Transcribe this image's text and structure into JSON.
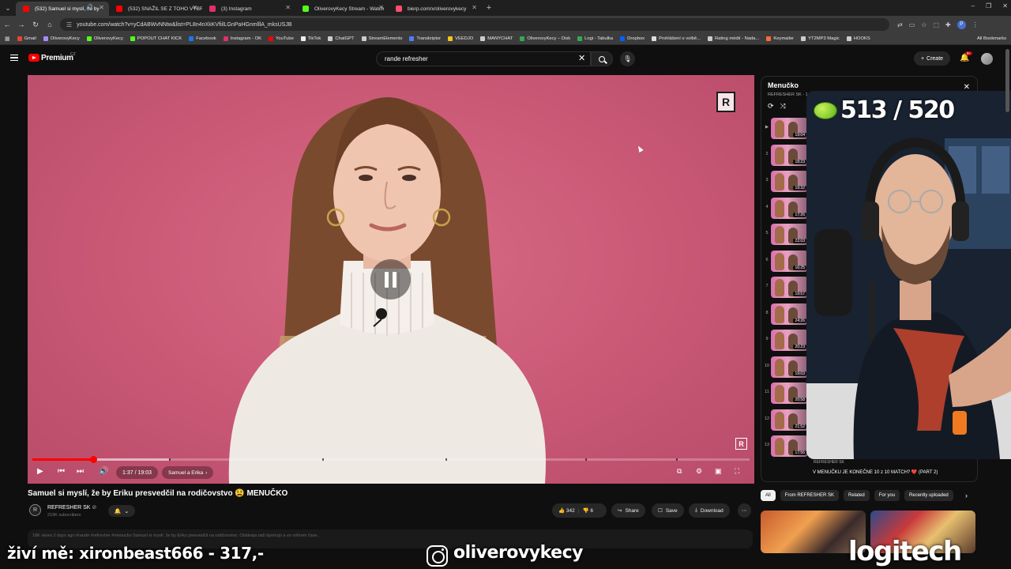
{
  "browser": {
    "tabs": [
      {
        "title": "(532) Samuel si myslí, že by",
        "favicon_color": "#ff0000",
        "active": true,
        "extra": "🔊"
      },
      {
        "title": "(532) SNAŽIL SE Z TOHO VYBR",
        "favicon_color": "#ff0000",
        "active": false
      },
      {
        "title": "(3) Instagram",
        "favicon_color": "#e1306c",
        "active": false
      },
      {
        "title": "OliverovyKecy Stream - Watch",
        "favicon_color": "#53fc18",
        "active": false
      },
      {
        "title": "bierp.com/x/oliverovykecy",
        "favicon_color": "#ff4d6d",
        "active": false
      }
    ],
    "url": "youtube.com/watch?v=yCdABWvNNtw&list=PL8n4nXkKVfiilLGnPaHGnmlllA_mksUSJB",
    "profile_initial": "P",
    "bookmarks": [
      {
        "label": "Gmail",
        "color": "#ea4335"
      },
      {
        "label": "OliverovyKecy",
        "color": "#a78bfa"
      },
      {
        "label": "OliverovyKecy",
        "color": "#53fc18"
      },
      {
        "label": "POPOUT CHAT KICK",
        "color": "#53fc18"
      },
      {
        "label": "Facebook",
        "color": "#1877f2"
      },
      {
        "label": "Instagram - OK",
        "color": "#e1306c"
      },
      {
        "label": "YouTube",
        "color": "#ff0000"
      },
      {
        "label": "TikTok",
        "color": "#eeeeee"
      },
      {
        "label": "ChatGPT",
        "color": "#cccccc"
      },
      {
        "label": "StreamElements",
        "color": "#cccccc"
      },
      {
        "label": "Transkriptor",
        "color": "#4f7cff"
      },
      {
        "label": "VEEDJO",
        "color": "#f5c518"
      },
      {
        "label": "MANYCHAT",
        "color": "#cccccc"
      },
      {
        "label": "OliverovyKecy – Disk",
        "color": "#34a853"
      },
      {
        "label": "Logi - Tabulka",
        "color": "#34a853"
      },
      {
        "label": "Dropbox",
        "color": "#0061ff"
      },
      {
        "label": "Prohlášení o volbě...",
        "color": "#dddddd"
      },
      {
        "label": "Rating médií - Nada...",
        "color": "#cccccc"
      },
      {
        "label": "Keymailer",
        "color": "#ff6b35"
      },
      {
        "label": "YT2MP3 Magic",
        "color": "#cccccc"
      },
      {
        "label": "HOOKS",
        "color": "#cccccc"
      }
    ],
    "all_bookmarks_label": "All Bookmarks"
  },
  "youtube": {
    "brand": "Premium",
    "region": "CZ",
    "search_query": "rande refresher",
    "create_label": "Create",
    "notif_badge": "9+"
  },
  "player": {
    "watermark": "R",
    "current_time": "1:37",
    "duration": "19:03",
    "time_display": "1:37 / 19:03",
    "chapter": "Samuel a Erika",
    "played_fraction": 0.085,
    "buffered_fraction": 0.19
  },
  "video": {
    "title": "Samuel si myslí, že by Eriku presvedčil na rodičovstvo 😫 MENUČKO",
    "channel": "REFRESHER SK",
    "subscribers": "219K subscribers",
    "likes": "342",
    "dislikes": "6",
    "share_label": "Share",
    "save_label": "Save",
    "download_label": "Download",
    "description": "18K views  2 days ago  #rande #refresher #menucko\nSamuel si myslí, že by Eriku presvedčil na rodičovstvo. Obidvaja radi športujú a vo voľnom čase..."
  },
  "playlist": {
    "title": "Menučko",
    "subtitle": "REFRESHER SK - 1",
    "items": [
      {
        "index": "▶",
        "duration": "19:04"
      },
      {
        "index": "2",
        "duration": "18:23"
      },
      {
        "index": "3",
        "duration": "19:32"
      },
      {
        "index": "4",
        "duration": "17:26"
      },
      {
        "index": "5",
        "duration": "22:03"
      },
      {
        "index": "6",
        "duration": "16:25"
      },
      {
        "index": "7",
        "duration": "19:57"
      },
      {
        "index": "8",
        "duration": "24:26"
      },
      {
        "index": "9",
        "duration": "20:23"
      },
      {
        "index": "10",
        "duration": "19:03"
      },
      {
        "index": "11",
        "duration": "20:58"
      },
      {
        "index": "12",
        "duration": "21:52"
      },
      {
        "index": "13",
        "duration": "17:56"
      }
    ],
    "bottom_channel": "REFRESHER SK",
    "bottom_title": "V MENUČKU JE KONEČNE 10 z 10 MATCH? ❤️ (PART 2)"
  },
  "chips": [
    "All",
    "From REFRESHER SK",
    "Related",
    "For you",
    "Recently uploaded"
  ],
  "overlay": {
    "counter": "513 / 520",
    "live_text": "živí mě: xironbeast666 - 317,-",
    "instagram_handle": "oliverovykecy",
    "sponsor": "logitech"
  }
}
